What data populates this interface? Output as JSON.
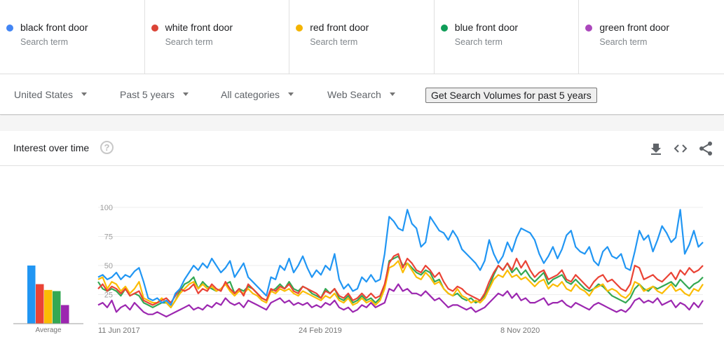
{
  "terms": [
    {
      "name": "black front door",
      "sub": "Search term",
      "color": "#4285f4"
    },
    {
      "name": "white front door",
      "sub": "Search term",
      "color": "#db4437"
    },
    {
      "name": "red front door",
      "sub": "Search term",
      "color": "#f4b400"
    },
    {
      "name": "blue front door",
      "sub": "Search term",
      "color": "#0f9d58"
    },
    {
      "name": "green front door",
      "sub": "Search term",
      "color": "#ab47bc"
    }
  ],
  "filters": {
    "region": "United States",
    "time": "Past 5 years",
    "category": "All categories",
    "search_type": "Web Search",
    "volume_button": "Get Search Volumes for past 5 years"
  },
  "card": {
    "title": "Interest over time",
    "help": "?",
    "icons": [
      "download-icon",
      "embed-icon",
      "share-icon"
    ]
  },
  "chart_data": {
    "type": "line",
    "title": "Interest over time",
    "ylim": [
      0,
      100
    ],
    "yticks": [
      25,
      50,
      75,
      100
    ],
    "xtick_labels": [
      "11 Jun 2017",
      "24 Feb 2019",
      "8 Nov 2020"
    ],
    "x_start": "11 Jun 2017",
    "interval": "weekly (sampled every 2 weeks)",
    "grid": true,
    "legend": "top",
    "average": {
      "label": "Average",
      "values": [
        50,
        34,
        29,
        28,
        16
      ]
    },
    "series": [
      {
        "name": "black front door",
        "color": "#2196f3",
        "values": [
          40,
          42,
          38,
          40,
          44,
          38,
          42,
          40,
          45,
          48,
          36,
          22,
          20,
          22,
          18,
          20,
          16,
          26,
          30,
          38,
          44,
          50,
          46,
          52,
          48,
          56,
          50,
          44,
          48,
          54,
          40,
          46,
          52,
          40,
          36,
          32,
          28,
          24,
          40,
          38,
          50,
          46,
          56,
          44,
          50,
          58,
          48,
          40,
          46,
          42,
          50,
          46,
          60,
          38,
          30,
          34,
          28,
          30,
          40,
          36,
          42,
          36,
          38,
          60,
          92,
          88,
          82,
          80,
          98,
          86,
          82,
          66,
          70,
          92,
          86,
          80,
          78,
          72,
          80,
          74,
          64,
          60,
          56,
          52,
          46,
          54,
          72,
          60,
          52,
          58,
          70,
          62,
          74,
          82,
          80,
          78,
          72,
          60,
          52,
          58,
          66,
          56,
          64,
          76,
          80,
          66,
          62,
          60,
          66,
          54,
          50,
          62,
          66,
          58,
          56,
          60,
          48,
          46,
          62,
          80,
          72,
          76,
          62,
          72,
          84,
          78,
          70,
          74,
          98,
          60,
          68,
          80,
          66,
          70
        ]
      },
      {
        "name": "white front door",
        "color": "#ea4335",
        "values": [
          30,
          34,
          28,
          32,
          30,
          26,
          30,
          24,
          26,
          28,
          20,
          18,
          16,
          18,
          20,
          22,
          18,
          24,
          30,
          28,
          30,
          34,
          26,
          30,
          28,
          34,
          30,
          28,
          36,
          30,
          26,
          30,
          24,
          34,
          30,
          26,
          22,
          20,
          30,
          28,
          32,
          30,
          34,
          28,
          26,
          32,
          30,
          28,
          26,
          22,
          28,
          26,
          30,
          24,
          22,
          26,
          20,
          22,
          26,
          22,
          26,
          22,
          24,
          34,
          52,
          58,
          60,
          48,
          56,
          52,
          46,
          44,
          50,
          46,
          40,
          44,
          36,
          30,
          28,
          32,
          30,
          26,
          24,
          22,
          20,
          26,
          36,
          44,
          50,
          46,
          52,
          46,
          56,
          48,
          54,
          46,
          40,
          44,
          46,
          38,
          40,
          42,
          46,
          38,
          36,
          42,
          38,
          34,
          30,
          36,
          40,
          42,
          36,
          38,
          34,
          30,
          28,
          34,
          50,
          48,
          38,
          40,
          42,
          38,
          36,
          40,
          44,
          38,
          46,
          42,
          48,
          44,
          46,
          50
        ]
      },
      {
        "name": "red front door",
        "color": "#fbbc04",
        "values": [
          38,
          40,
          30,
          36,
          34,
          28,
          32,
          26,
          30,
          36,
          22,
          20,
          18,
          18,
          22,
          18,
          14,
          20,
          26,
          30,
          34,
          36,
          30,
          34,
          30,
          32,
          28,
          30,
          34,
          28,
          24,
          28,
          26,
          30,
          26,
          24,
          20,
          18,
          28,
          26,
          30,
          28,
          30,
          26,
          24,
          28,
          26,
          24,
          22,
          20,
          24,
          22,
          26,
          20,
          18,
          22,
          16,
          18,
          22,
          18,
          20,
          16,
          20,
          30,
          48,
          50,
          54,
          44,
          52,
          46,
          40,
          38,
          44,
          40,
          34,
          36,
          30,
          26,
          24,
          30,
          24,
          22,
          18,
          20,
          18,
          22,
          30,
          38,
          42,
          40,
          46,
          40,
          42,
          38,
          40,
          36,
          32,
          36,
          38,
          30,
          34,
          32,
          36,
          30,
          28,
          34,
          30,
          28,
          24,
          30,
          32,
          34,
          28,
          30,
          28,
          24,
          22,
          26,
          36,
          34,
          28,
          30,
          32,
          28,
          26,
          30,
          34,
          28,
          30,
          26,
          24,
          30,
          28,
          34
        ]
      },
      {
        "name": "blue front door",
        "color": "#34a853",
        "values": [
          36,
          30,
          28,
          30,
          28,
          24,
          30,
          24,
          26,
          24,
          18,
          16,
          14,
          16,
          18,
          18,
          14,
          20,
          28,
          34,
          36,
          40,
          30,
          36,
          32,
          30,
          28,
          30,
          34,
          36,
          26,
          30,
          28,
          32,
          30,
          26,
          22,
          20,
          28,
          30,
          34,
          30,
          36,
          30,
          28,
          32,
          30,
          26,
          24,
          22,
          30,
          26,
          30,
          22,
          20,
          24,
          18,
          20,
          24,
          20,
          22,
          18,
          22,
          32,
          54,
          56,
          58,
          50,
          52,
          48,
          44,
          42,
          46,
          44,
          36,
          38,
          30,
          26,
          24,
          26,
          22,
          20,
          22,
          18,
          20,
          24,
          32,
          42,
          50,
          46,
          52,
          44,
          48,
          42,
          46,
          40,
          36,
          40,
          44,
          34,
          38,
          40,
          42,
          36,
          34,
          38,
          34,
          30,
          28,
          30,
          34,
          32,
          28,
          24,
          22,
          20,
          18,
          22,
          30,
          34,
          30,
          28,
          32,
          30,
          32,
          34,
          36,
          32,
          38,
          34,
          30,
          34,
          36,
          40
        ]
      },
      {
        "name": "green front door",
        "color": "#9c27b0",
        "values": [
          16,
          18,
          14,
          20,
          10,
          14,
          16,
          12,
          18,
          14,
          10,
          8,
          8,
          10,
          8,
          6,
          8,
          10,
          12,
          14,
          16,
          12,
          14,
          12,
          16,
          14,
          18,
          16,
          22,
          18,
          16,
          18,
          14,
          20,
          18,
          16,
          14,
          12,
          18,
          20,
          22,
          18,
          20,
          16,
          18,
          16,
          18,
          14,
          16,
          14,
          18,
          16,
          20,
          14,
          12,
          14,
          10,
          12,
          16,
          14,
          18,
          14,
          16,
          18,
          30,
          28,
          34,
          28,
          30,
          26,
          26,
          24,
          28,
          24,
          20,
          22,
          18,
          14,
          16,
          16,
          14,
          12,
          14,
          10,
          12,
          14,
          18,
          22,
          26,
          24,
          28,
          22,
          26,
          20,
          22,
          18,
          18,
          20,
          22,
          16,
          18,
          18,
          20,
          16,
          14,
          18,
          16,
          14,
          12,
          16,
          18,
          16,
          14,
          12,
          10,
          12,
          10,
          14,
          20,
          22,
          18,
          20,
          18,
          22,
          16,
          18,
          20,
          14,
          18,
          16,
          12,
          18,
          14,
          20
        ]
      }
    ]
  }
}
